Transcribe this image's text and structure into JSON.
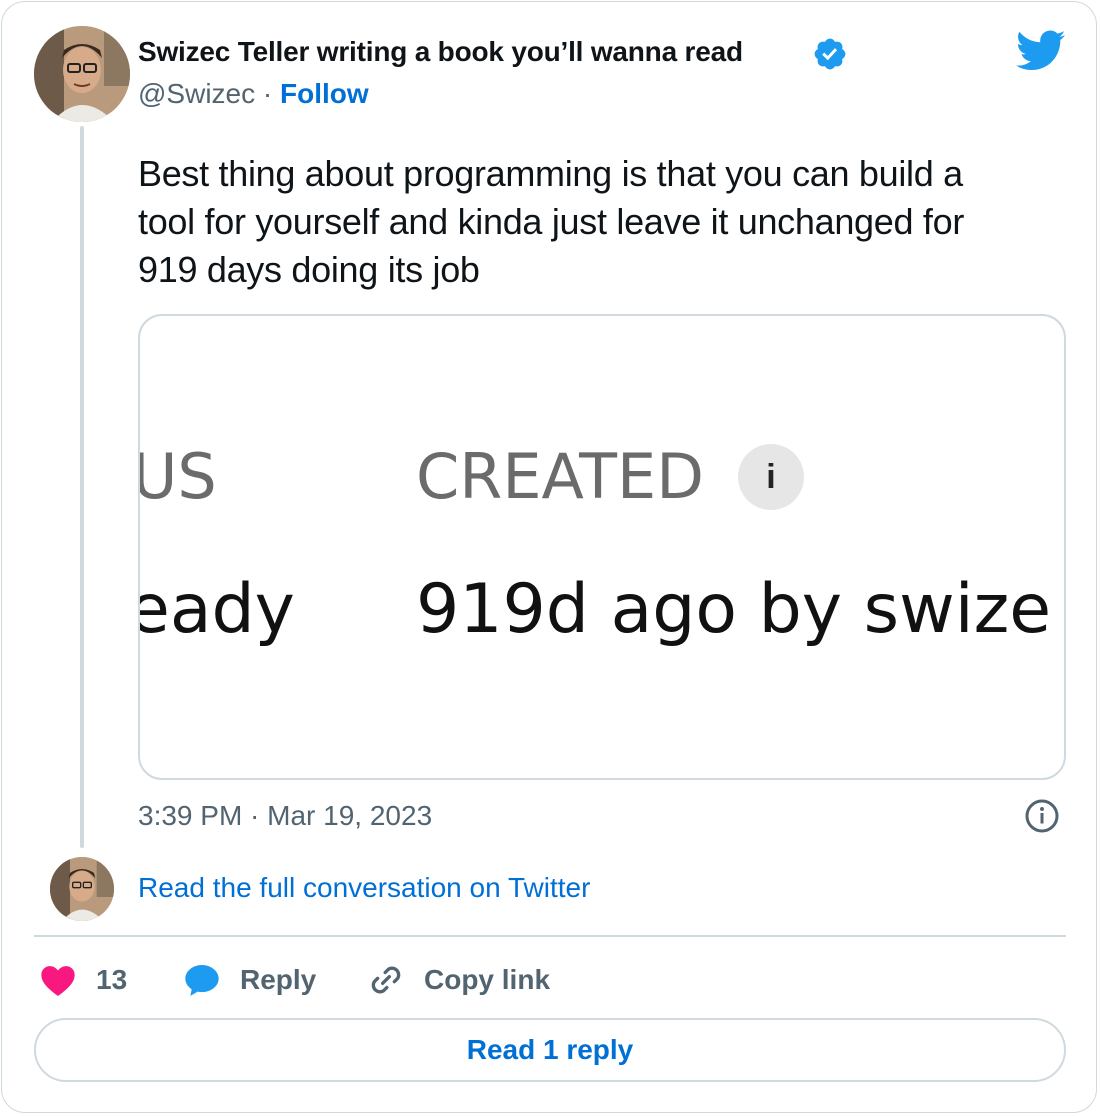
{
  "author": {
    "name": "Swizec Teller writing a book you’ll wanna read",
    "handle": "@Swizec",
    "separator": "·",
    "follow_label": "Follow"
  },
  "tweet": {
    "text_line1": "Best thing about programming is that you can build a",
    "text_line2": "tool for yourself and kinda just leave it unchanged for",
    "text_line3": "919 days doing its job",
    "timestamp": "3:39 PM · Mar 19, 2023"
  },
  "media": {
    "status_header": "US",
    "created_header": "CREATED",
    "info_glyph": "i",
    "status_value": "eady",
    "created_value": "919d ago by swize"
  },
  "conversation_link": "Read the full conversation on Twitter",
  "actions": {
    "like_count": "13",
    "reply_label": "Reply",
    "copy_label": "Copy link"
  },
  "read_replies_label": "Read 1 reply",
  "colors": {
    "link": "#006fd6",
    "like": "#f91880",
    "reply": "#1d9bf0",
    "border": "#cfd9de",
    "muted": "#536471"
  },
  "icons": [
    "verified-badge-icon",
    "twitter-bird-icon",
    "info-icon",
    "heart-icon",
    "reply-bubble-icon",
    "link-icon"
  ]
}
